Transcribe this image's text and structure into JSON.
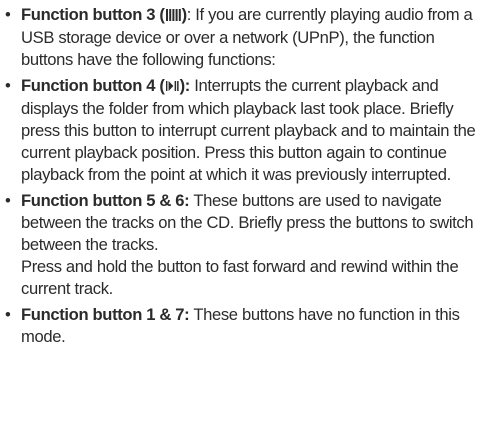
{
  "items": [
    {
      "bullet": "•",
      "label_start": "Function button 3 (",
      "icon": "equalizer-bars-icon",
      "label_end": ")",
      "text": ": If you are currently playing audio from a USB storage device or over a network (UPnP), the function buttons have the following functions:"
    },
    {
      "bullet": "•",
      "label_start": "Function button 4 (",
      "icon": "play-pause-icon",
      "label_end": "):",
      "text": " Interrupts the current playback and displays the folder from which playback last took place. Briefly press this button to interrupt current playback and to maintain the current playback position. Press this button again to continue playback from the point at which it was previously interrupted."
    },
    {
      "bullet": "•",
      "label": "Function button 5 & 6:",
      "text": " These buttons are used to navigate between the tracks on the CD. Briefly press the buttons to switch between the tracks.",
      "text2": "Press and hold the button to fast forward and rewind within the current track."
    },
    {
      "bullet": "•",
      "label": "Function button 1 & 7:",
      "text": " These buttons have no function in this mode."
    }
  ]
}
